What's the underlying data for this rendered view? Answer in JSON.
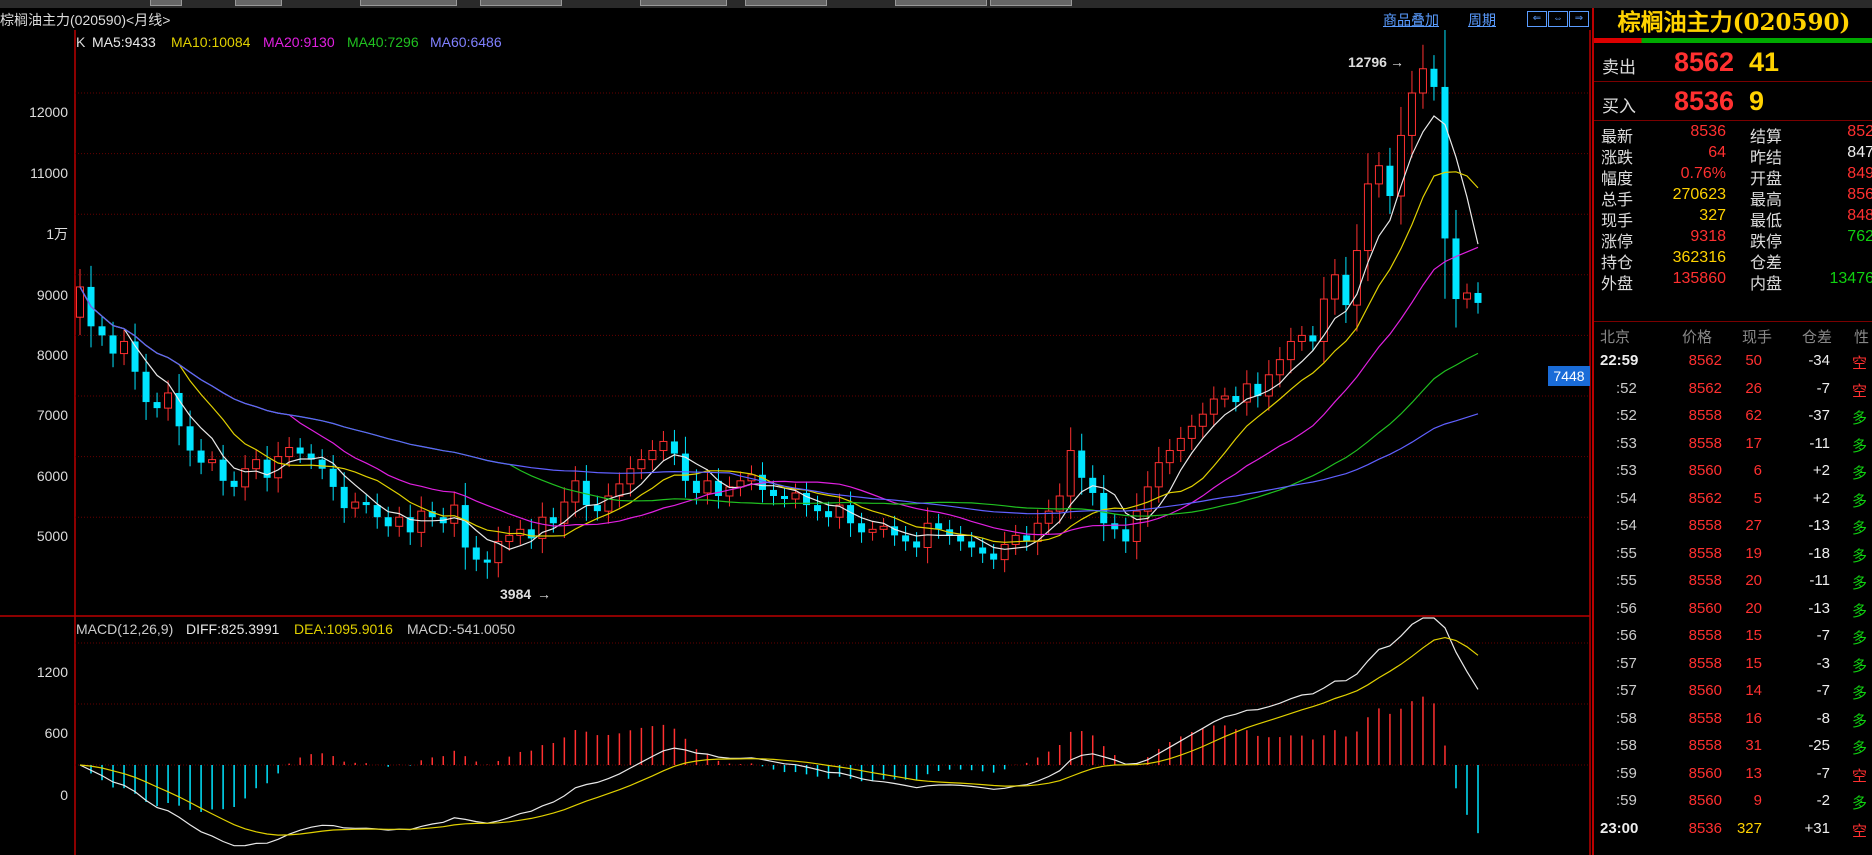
{
  "header": {
    "symbol_title": "棕榈油主力(020590)<月线>",
    "link_overlay": "商品叠加",
    "link_period": "周期",
    "nav_buttons": [
      "⇐",
      "⇔",
      "⇒"
    ]
  },
  "kline": {
    "ma_labels": {
      "k": "K",
      "ma5": "MA5:9433",
      "ma10": "MA10:10084",
      "ma20": "MA20:9130",
      "ma40": "MA40:7296",
      "ma60": "MA60:6486"
    },
    "colors": {
      "ma5": "#e8e8e8",
      "ma10": "#e0d000",
      "ma20": "#e020e0",
      "ma40": "#20c020",
      "ma60": "#6060ff",
      "up": "#ff3030",
      "down": "#00e5ff"
    },
    "y_ticks": [
      "12000",
      "11000",
      "1万",
      "9000",
      "8000",
      "7000",
      "6000",
      "5000"
    ],
    "high_label": "12796",
    "low_label": "3984",
    "cursor_price": "7448"
  },
  "macd": {
    "label": "MACD(12,26,9)",
    "diff": "DIFF:825.3991",
    "dea": "DEA:1095.9016",
    "macd": "MACD:-541.0050",
    "y_ticks": [
      "1200",
      "600",
      "0"
    ]
  },
  "chart_data": {
    "type": "candlestick",
    "title": "棕榈油主力(020590)<月线>",
    "ylim": [
      3700,
      13500
    ],
    "high": 12796,
    "low": 3984,
    "last_close": 8536,
    "closes": [
      8800,
      8150,
      8000,
      7700,
      7900,
      7400,
      6900,
      6800,
      7050,
      6500,
      6100,
      5900,
      5950,
      5600,
      5500,
      5800,
      5950,
      5650,
      6000,
      6150,
      6050,
      5950,
      5800,
      5500,
      5150,
      5250,
      5200,
      5000,
      4850,
      5000,
      4750,
      5100,
      5000,
      4900,
      5200,
      4500,
      4300,
      4250,
      4600,
      4700,
      4800,
      4650,
      5000,
      4900,
      5250,
      5600,
      5200,
      5100,
      5350,
      5550,
      5800,
      5950,
      6100,
      6250,
      6050,
      5600,
      5400,
      5600,
      5350,
      5500,
      5600,
      5700,
      5450,
      5350,
      5300,
      5400,
      5200,
      5100,
      5000,
      5200,
      4900,
      4750,
      4800,
      4850,
      4700,
      4600,
      4500,
      4900,
      4800,
      4700,
      4600,
      4500,
      4400,
      4300,
      4550,
      4700,
      4600,
      4900,
      5100,
      5350,
      6100,
      5650,
      5400,
      4900,
      4800,
      4600,
      5100,
      5500,
      5900,
      6100,
      6300,
      6500,
      6700,
      6950,
      7000,
      6900,
      7200,
      7000,
      7350,
      7600,
      7900,
      8000,
      7900,
      8600,
      9000,
      8500,
      9400,
      10500,
      10800,
      10300,
      11300,
      12000,
      12400,
      12100,
      9600,
      8600,
      8700,
      8536
    ]
  },
  "quote_panel": {
    "title": "棕榈油主力(020590)",
    "sell_label": "卖出",
    "sell_price": "8562",
    "sell_vol": "41",
    "buy_label": "买入",
    "buy_price": "8536",
    "buy_vol": "9",
    "rows": [
      {
        "l": "最新",
        "lv": "8536",
        "r": "结算",
        "rv": "852",
        "lvc": "red",
        "rvc": "red"
      },
      {
        "l": "涨跌",
        "lv": "64",
        "r": "昨结",
        "rv": "847",
        "lvc": "red",
        "rvc": "wht"
      },
      {
        "l": "幅度",
        "lv": "0.76%",
        "r": "开盘",
        "rv": "849",
        "lvc": "red",
        "rvc": "red"
      },
      {
        "l": "总手",
        "lv": "270623",
        "r": "最高",
        "rv": "856",
        "lvc": "yel",
        "rvc": "red"
      },
      {
        "l": "现手",
        "lv": "327",
        "r": "最低",
        "rv": "848",
        "lvc": "yel",
        "rvc": "red"
      },
      {
        "l": "涨停",
        "lv": "9318",
        "r": "跌停",
        "rv": "762",
        "lvc": "red",
        "rvc": "grn"
      },
      {
        "l": "持仓",
        "lv": "362316",
        "r": "仓差",
        "rv": "",
        "lvc": "yel",
        "rvc": "wht"
      },
      {
        "l": "外盘",
        "lv": "135860",
        "r": "内盘",
        "rv": "13476",
        "lvc": "red",
        "rvc": "grn"
      }
    ],
    "table_headers": [
      "北京",
      "价格",
      "现手",
      "仓差",
      "性"
    ],
    "ticks": [
      {
        "t": "22:59",
        "p": "8562",
        "v": "50",
        "d": "-34",
        "k": "空"
      },
      {
        "t": ":52",
        "p": "8562",
        "v": "26",
        "d": "-7",
        "k": "空"
      },
      {
        "t": ":52",
        "p": "8558",
        "v": "62",
        "d": "-37",
        "k": "多"
      },
      {
        "t": ":53",
        "p": "8558",
        "v": "17",
        "d": "-11",
        "k": "多"
      },
      {
        "t": ":53",
        "p": "8560",
        "v": "6",
        "d": "+2",
        "k": "多"
      },
      {
        "t": ":54",
        "p": "8562",
        "v": "5",
        "d": "+2",
        "k": "多"
      },
      {
        "t": ":54",
        "p": "8558",
        "v": "27",
        "d": "-13",
        "k": "多"
      },
      {
        "t": ":55",
        "p": "8558",
        "v": "19",
        "d": "-18",
        "k": "多"
      },
      {
        "t": ":55",
        "p": "8558",
        "v": "20",
        "d": "-11",
        "k": "多"
      },
      {
        "t": ":56",
        "p": "8560",
        "v": "20",
        "d": "-13",
        "k": "多"
      },
      {
        "t": ":56",
        "p": "8558",
        "v": "15",
        "d": "-7",
        "k": "多"
      },
      {
        "t": ":57",
        "p": "8558",
        "v": "15",
        "d": "-3",
        "k": "多"
      },
      {
        "t": ":57",
        "p": "8560",
        "v": "14",
        "d": "-7",
        "k": "多"
      },
      {
        "t": ":58",
        "p": "8558",
        "v": "16",
        "d": "-8",
        "k": "多"
      },
      {
        "t": ":58",
        "p": "8558",
        "v": "31",
        "d": "-25",
        "k": "多"
      },
      {
        "t": ":59",
        "p": "8560",
        "v": "13",
        "d": "-7",
        "k": "空"
      },
      {
        "t": ":59",
        "p": "8560",
        "v": "9",
        "d": "-2",
        "k": "多"
      },
      {
        "t": "23:00",
        "p": "8536",
        "v": "327",
        "d": "+31",
        "k": "空"
      }
    ]
  }
}
